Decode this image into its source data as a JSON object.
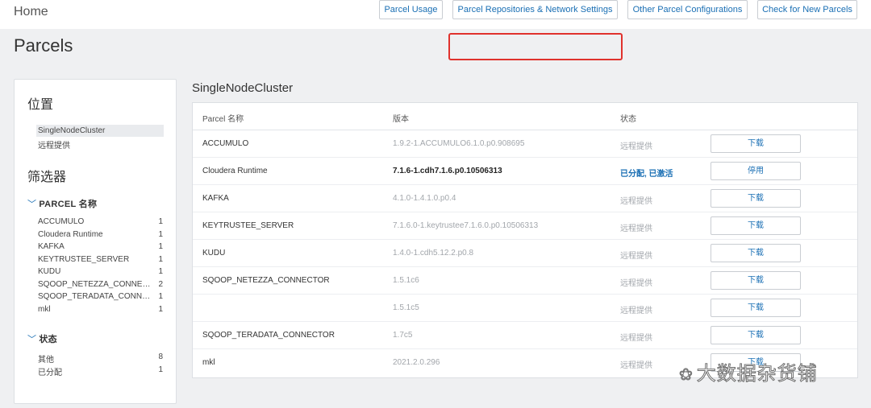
{
  "breadcrumb": "Home",
  "page_title": "Parcels",
  "actions": {
    "parcel_usage": "Parcel Usage",
    "repositories": "Parcel Repositories & Network Settings",
    "other_config": "Other Parcel Configurations",
    "check_new": "Check for New Parcels"
  },
  "sidebar": {
    "location_heading": "位置",
    "locations": [
      "SingleNodeCluster",
      "远程提供"
    ],
    "filters_heading": "筛选器",
    "parcel_group": {
      "label": "PARCEL 名称",
      "items": [
        {
          "name": "ACCUMULO",
          "count": "1"
        },
        {
          "name": "Cloudera Runtime",
          "count": "1"
        },
        {
          "name": "KAFKA",
          "count": "1"
        },
        {
          "name": "KEYTRUSTEE_SERVER",
          "count": "1"
        },
        {
          "name": "KUDU",
          "count": "1"
        },
        {
          "name": "SQOOP_NETEZZA_CONNECTOR",
          "count": "2"
        },
        {
          "name": "SQOOP_TERADATA_CONNECT…",
          "count": "1"
        },
        {
          "name": "mkl",
          "count": "1"
        }
      ]
    },
    "status_group": {
      "label": "状态",
      "items": [
        {
          "name": "其他",
          "count": "8"
        },
        {
          "name": "已分配",
          "count": "1"
        }
      ]
    }
  },
  "cluster_title": "SingleNodeCluster",
  "table": {
    "headers": {
      "name": "Parcel 名称",
      "version": "版本",
      "status": "状态"
    },
    "rows": [
      {
        "name": "ACCUMULO",
        "version": "1.9.2-1.ACCUMULO6.1.0.p0.908695",
        "status": "远程提供",
        "action": "下载"
      },
      {
        "name": "Cloudera Runtime",
        "version": "7.1.6-1.cdh7.1.6.p0.10506313",
        "status": "已分配, 已激活",
        "action": "停用"
      },
      {
        "name": "KAFKA",
        "version": "4.1.0-1.4.1.0.p0.4",
        "status": "远程提供",
        "action": "下载"
      },
      {
        "name": "KEYTRUSTEE_SERVER",
        "version": "7.1.6.0-1.keytrustee7.1.6.0.p0.10506313",
        "status": "远程提供",
        "action": "下载"
      },
      {
        "name": "KUDU",
        "version": "1.4.0-1.cdh5.12.2.p0.8",
        "status": "远程提供",
        "action": "下载"
      },
      {
        "name": "SQOOP_NETEZZA_CONNECTOR",
        "version": "1.5.1c6",
        "status": "远程提供",
        "action": "下载"
      },
      {
        "name": "",
        "version": "1.5.1c5",
        "status": "远程提供",
        "action": "下载"
      },
      {
        "name": "SQOOP_TERADATA_CONNECTOR",
        "version": "1.7c5",
        "status": "远程提供",
        "action": "下载"
      },
      {
        "name": "mkl",
        "version": "2021.2.0.296",
        "status": "远程提供",
        "action": "下载"
      }
    ]
  },
  "watermark": "大数据杂货铺",
  "colors": {
    "link": "#1a6fb4",
    "highlight": "#e0322d",
    "background": "#eff0f2"
  }
}
